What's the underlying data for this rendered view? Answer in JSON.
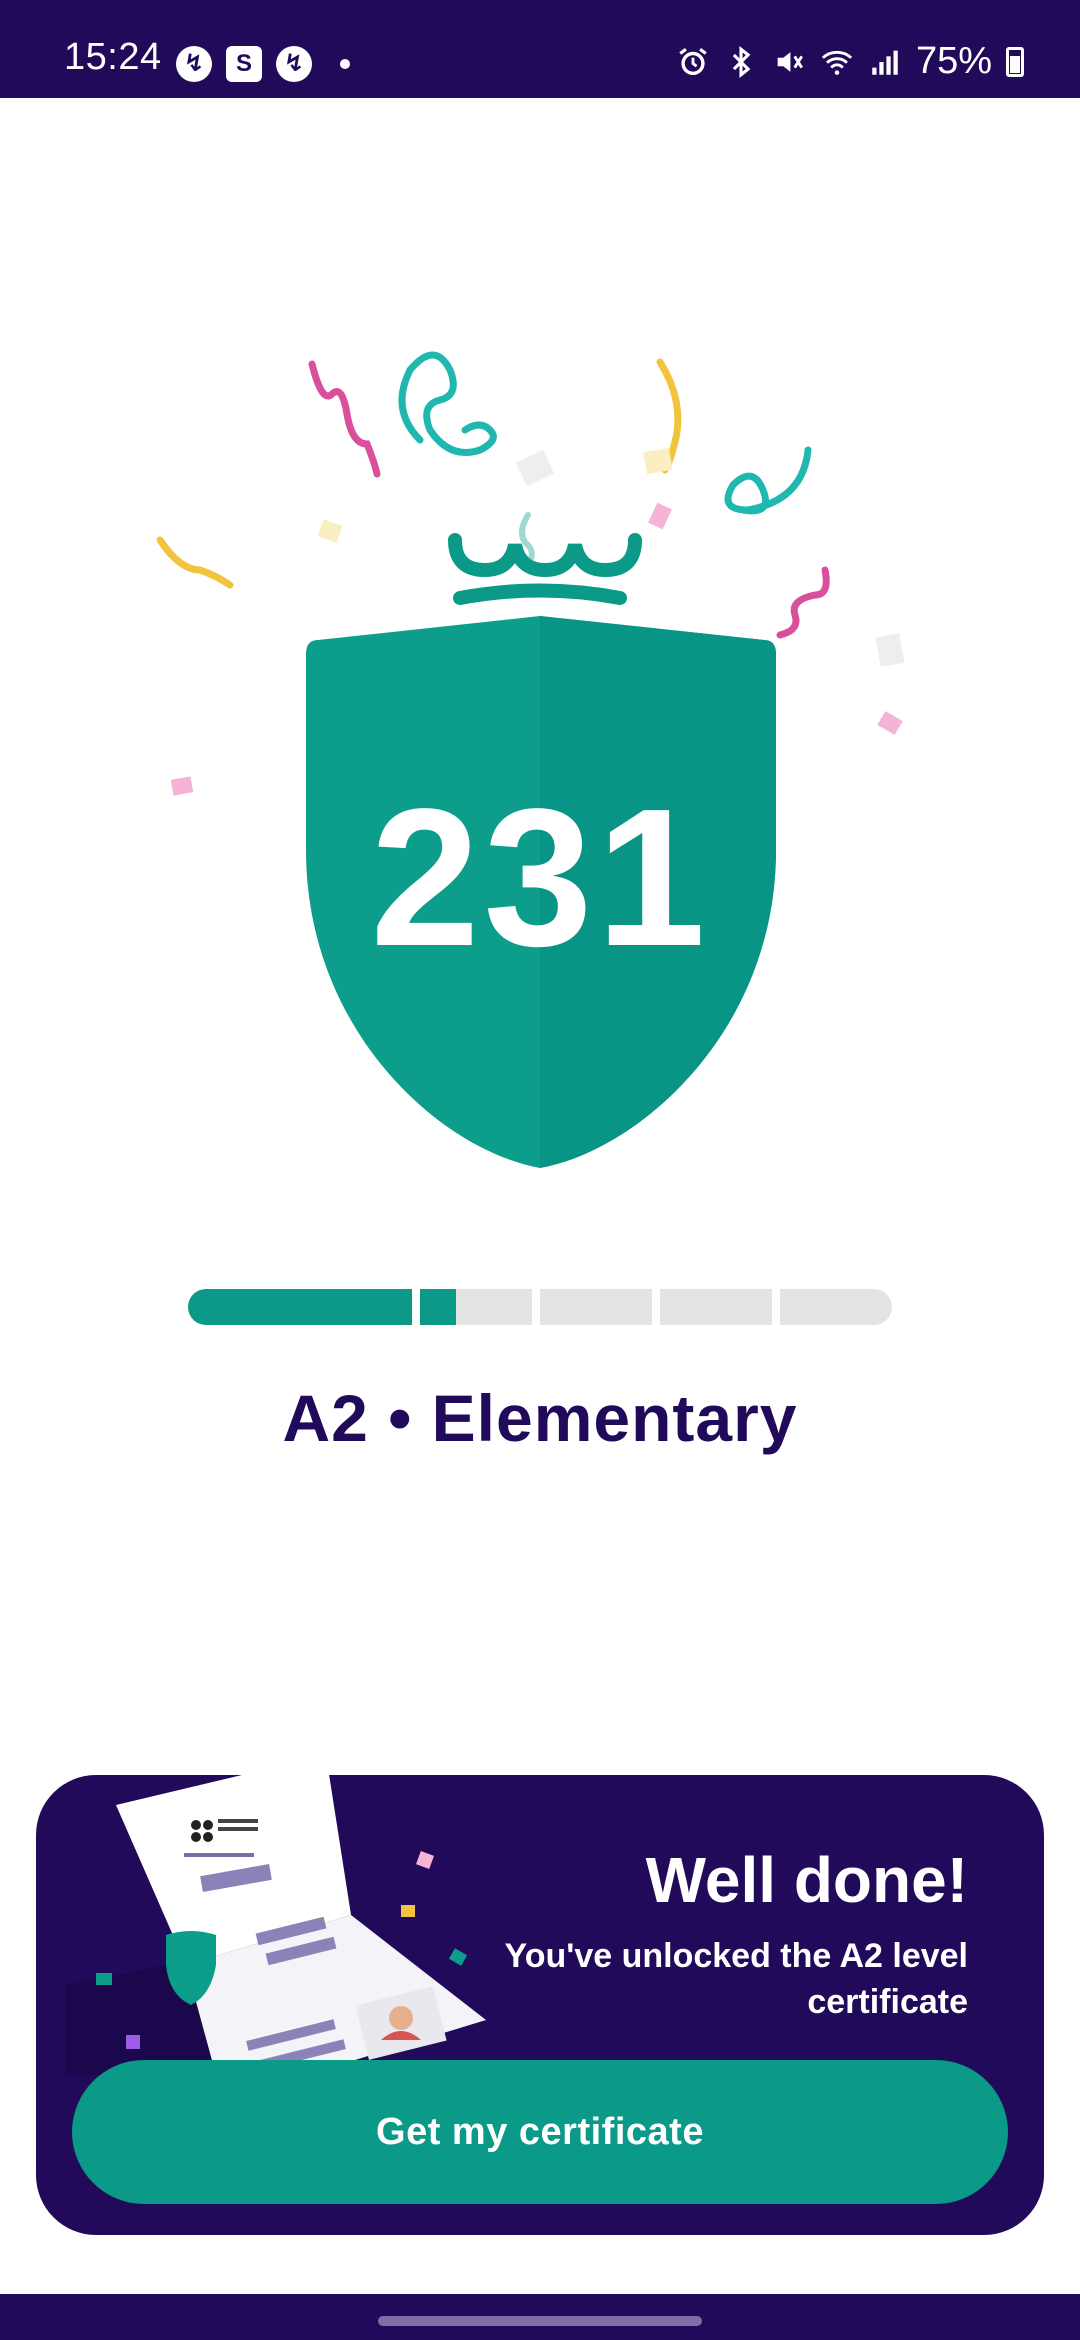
{
  "status_bar": {
    "time": "15:24",
    "battery": "75%",
    "icons": [
      "messenger-icon",
      "shop-icon",
      "messenger-icon",
      "alarm-icon",
      "bluetooth-icon",
      "mute-icon",
      "wifi-icon",
      "signal-icon",
      "battery-icon"
    ]
  },
  "result": {
    "score": "231",
    "level": "A2 • Elementary",
    "progress_segments": [
      1.0,
      0.32,
      0.0,
      0.0,
      0.0
    ]
  },
  "certificate_card": {
    "title": "Well done!",
    "subtitle": "You've unlocked the A2 level certificate",
    "button_label": "Get my certificate"
  },
  "colors": {
    "brand_dark": "#220a5a",
    "accent_teal": "#0a9a87",
    "track_gray": "#e3e3e3"
  }
}
